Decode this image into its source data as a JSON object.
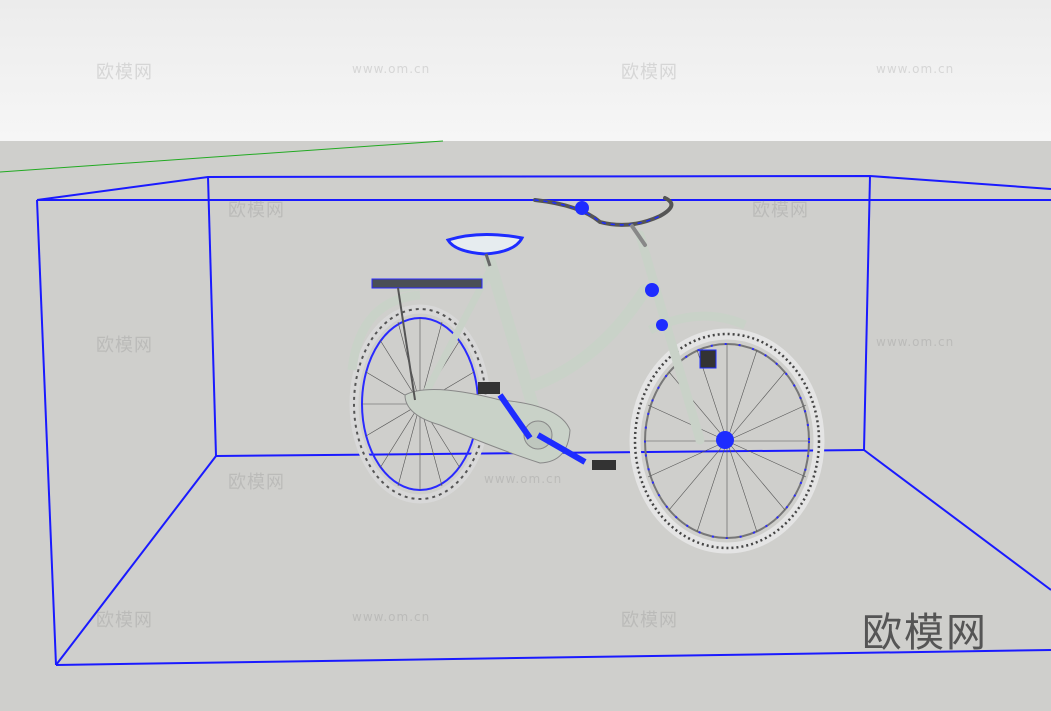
{
  "watermarks": {
    "brand": "欧模网",
    "url": "www.om.cn"
  },
  "logo_text": "欧模网",
  "colors": {
    "selection_box": "#1a1aff",
    "axis_green": "#22aa22",
    "bike_frame": "#c9d2c8",
    "bike_dark": "#666666",
    "selection_vertex": "#1e2cff"
  }
}
